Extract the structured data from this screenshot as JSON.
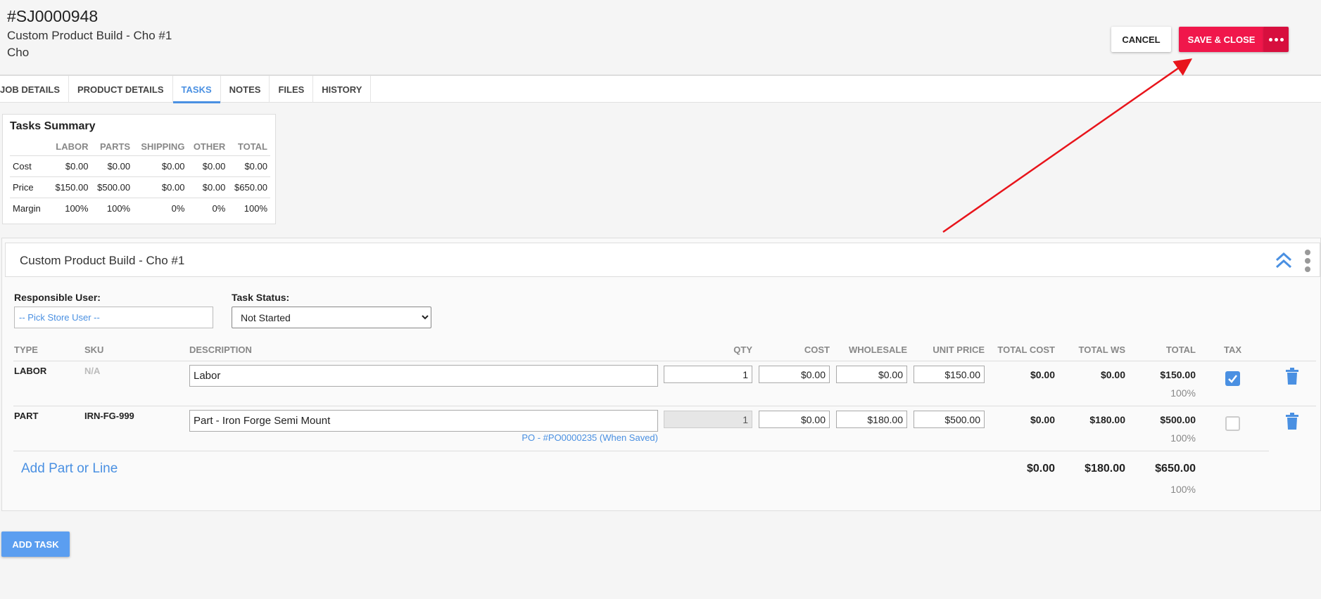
{
  "header": {
    "job_id": "#SJ0000948",
    "job_name": "Custom Product Build - Cho #1",
    "customer": "Cho",
    "cancel_label": "CANCEL",
    "save_label": "SAVE & CLOSE"
  },
  "tabs": [
    {
      "label": "JOB DETAILS",
      "active": false
    },
    {
      "label": "PRODUCT DETAILS",
      "active": false
    },
    {
      "label": "TASKS",
      "active": true
    },
    {
      "label": "NOTES",
      "active": false
    },
    {
      "label": "FILES",
      "active": false
    },
    {
      "label": "HISTORY",
      "active": false
    }
  ],
  "summary": {
    "title": "Tasks Summary",
    "columns": [
      "LABOR",
      "PARTS",
      "SHIPPING",
      "OTHER",
      "TOTAL"
    ],
    "rows": [
      {
        "label": "Cost",
        "values": [
          "$0.00",
          "$0.00",
          "$0.00",
          "$0.00",
          "$0.00"
        ]
      },
      {
        "label": "Price",
        "values": [
          "$150.00",
          "$500.00",
          "$0.00",
          "$0.00",
          "$650.00"
        ]
      },
      {
        "label": "Margin",
        "values": [
          "100%",
          "100%",
          "0%",
          "0%",
          "100%"
        ]
      }
    ]
  },
  "task": {
    "title": "Custom Product Build - Cho #1",
    "responsible_user_label": "Responsible User:",
    "responsible_user_placeholder": "-- Pick Store User --",
    "task_status_label": "Task Status:",
    "task_status_value": "Not Started",
    "columns": {
      "type": "TYPE",
      "sku": "SKU",
      "description": "DESCRIPTION",
      "qty": "QTY",
      "cost": "COST",
      "wholesale": "WHOLESALE",
      "unit_price": "UNIT PRICE",
      "total_cost": "TOTAL COST",
      "total_ws": "TOTAL WS",
      "total": "TOTAL",
      "tax": "TAX"
    },
    "lines": [
      {
        "type": "LABOR",
        "sku": "N/A",
        "description": "Labor",
        "qty": "1",
        "cost": "$0.00",
        "wholesale": "$0.00",
        "unit_price": "$150.00",
        "total_cost": "$0.00",
        "total_ws": "$0.00",
        "total": "$150.00",
        "margin": "100%",
        "tax": true
      },
      {
        "type": "PART",
        "sku": "IRN-FG-999",
        "description": "Part - Iron Forge Semi Mount",
        "qty": "1",
        "cost": "$0.00",
        "wholesale": "$180.00",
        "unit_price": "$500.00",
        "total_cost": "$0.00",
        "total_ws": "$180.00",
        "total": "$500.00",
        "margin": "100%",
        "tax": false,
        "po_link": "PO - #PO0000235 (When Saved)"
      }
    ],
    "add_line_label": "Add Part or Line",
    "totals": {
      "total_cost": "$0.00",
      "total_ws": "$180.00",
      "total": "$650.00",
      "margin": "100%"
    }
  },
  "add_task_label": "ADD TASK",
  "colors": {
    "accent": "#4a90e2",
    "save": "#f0174b",
    "annotation_arrow": "#e8141b"
  }
}
